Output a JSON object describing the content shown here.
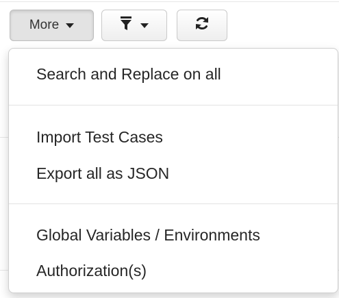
{
  "toolbar": {
    "more_label": "More",
    "filter_icon": "filter-icon",
    "refresh_icon": "refresh-icon"
  },
  "menu": {
    "items": [
      {
        "label": "Search and Replace on all"
      },
      {
        "label": "Import Test Cases"
      },
      {
        "label": "Export all as JSON"
      },
      {
        "label": "Global Variables / Environments"
      },
      {
        "label": "Authorization(s)"
      }
    ]
  }
}
